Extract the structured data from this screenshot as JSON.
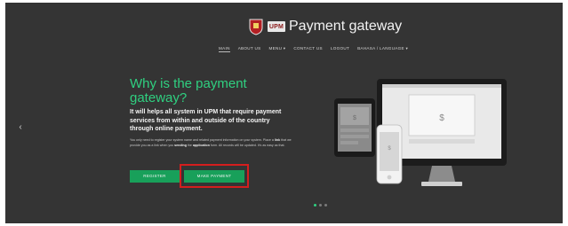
{
  "header": {
    "logo_text": "UPM",
    "title": "Payment gateway"
  },
  "nav": [
    {
      "label": "MAIN",
      "active": true
    },
    {
      "label": "ABOUT US",
      "active": false
    },
    {
      "label": "MENU ▾",
      "active": false
    },
    {
      "label": "CONTACT US",
      "active": false
    },
    {
      "label": "LOGOUT",
      "active": false
    },
    {
      "label": "BAHASA / LANGUAGE ▾",
      "active": false
    }
  ],
  "hero": {
    "title": "Why is the payment gateway?",
    "lead": "It will helps all system in UPM that require payment services from within and outside of the country through online payment.",
    "small_1": "You only need to register your system name and related payment information on your system. Place a ",
    "small_link": "link",
    "small_2": " that we provide you as a link when you ",
    "small_sending": "sending",
    "small_3": " the ",
    "small_application": "application",
    "small_4": " form. All records will be updated. It's as easy as that."
  },
  "buttons": {
    "register": "REGISTER",
    "make_payment": "MAKE PAYMENT"
  },
  "icons": {
    "prev": "chevron-left-icon",
    "devices": "devices-illustration"
  },
  "carousel": {
    "slides": 3,
    "active_index": 0
  },
  "colors": {
    "accent": "#2fd080",
    "button": "#18a05a",
    "highlight": "#d41e1e",
    "background": "#343434"
  }
}
